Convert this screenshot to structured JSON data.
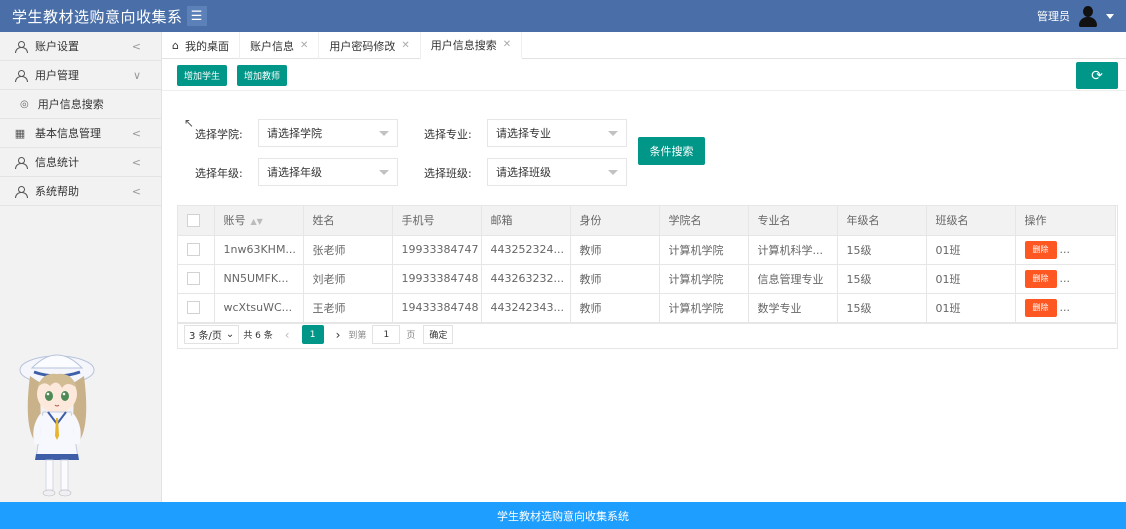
{
  "header": {
    "title": "学生教材选购意向收集系",
    "menu_toggle_icon": "menu-icon",
    "admin_label": "管理员"
  },
  "sidebar": {
    "items": [
      {
        "label": "账户设置",
        "icon": "user-icon",
        "arrow": "<"
      },
      {
        "label": "用户管理",
        "icon": "user-icon",
        "arrow": "∨"
      },
      {
        "label": "用户信息搜索",
        "icon": "circle-icon",
        "sub": true
      },
      {
        "label": "基本信息管理",
        "icon": "table-icon",
        "arrow": "<"
      },
      {
        "label": "信息统计",
        "icon": "user-icon",
        "arrow": "<"
      },
      {
        "label": "系统帮助",
        "icon": "user-icon",
        "arrow": "<"
      }
    ]
  },
  "tabs": [
    {
      "label": "我的桌面",
      "icon": "home-icon",
      "closable": false
    },
    {
      "label": "账户信息",
      "closable": true
    },
    {
      "label": "用户密码修改",
      "closable": true
    },
    {
      "label": "用户信息搜索",
      "closable": true,
      "active": true
    }
  ],
  "toolbar": {
    "add_student": "增加学生",
    "add_teacher": "增加教师",
    "refresh_icon": "refresh-icon"
  },
  "filters": {
    "college_label": "选择学院:",
    "college_value": "请选择学院",
    "major_label": "选择专业:",
    "major_value": "请选择专业",
    "grade_label": "选择年级:",
    "grade_value": "请选择年级",
    "class_label": "选择班级:",
    "class_value": "请选择班级",
    "search_button": "条件搜索"
  },
  "table": {
    "columns": [
      "账号",
      "姓名",
      "手机号",
      "邮箱",
      "身份",
      "学院名",
      "专业名",
      "年级名",
      "班级名",
      "操作"
    ],
    "rows": [
      {
        "account": "1nw63KHM...",
        "name": "张老师",
        "phone": "19933384747",
        "email": "443252324...",
        "role": "教师",
        "college": "计算机学院",
        "major": "计算机科学...",
        "grade": "15级",
        "class": "01班"
      },
      {
        "account": "NN5UMFK...",
        "name": "刘老师",
        "phone": "19933384748",
        "email": "443263232...",
        "role": "教师",
        "college": "计算机学院",
        "major": "信息管理专业",
        "grade": "15级",
        "class": "01班"
      },
      {
        "account": "wcXtsuWC...",
        "name": "王老师",
        "phone": "19433384748",
        "email": "443242343...",
        "role": "教师",
        "college": "计算机学院",
        "major": "数学专业",
        "grade": "15级",
        "class": "01班"
      }
    ],
    "delete_label": "删除",
    "more_label": "..."
  },
  "pager": {
    "limit": "3 条/页",
    "total": "共 6 条",
    "current_page": "1",
    "goto_label": "到第",
    "goto_value": "1",
    "page_unit": "页",
    "confirm": "确定"
  },
  "footer": {
    "text": "学生教材选购意向收集系统"
  }
}
